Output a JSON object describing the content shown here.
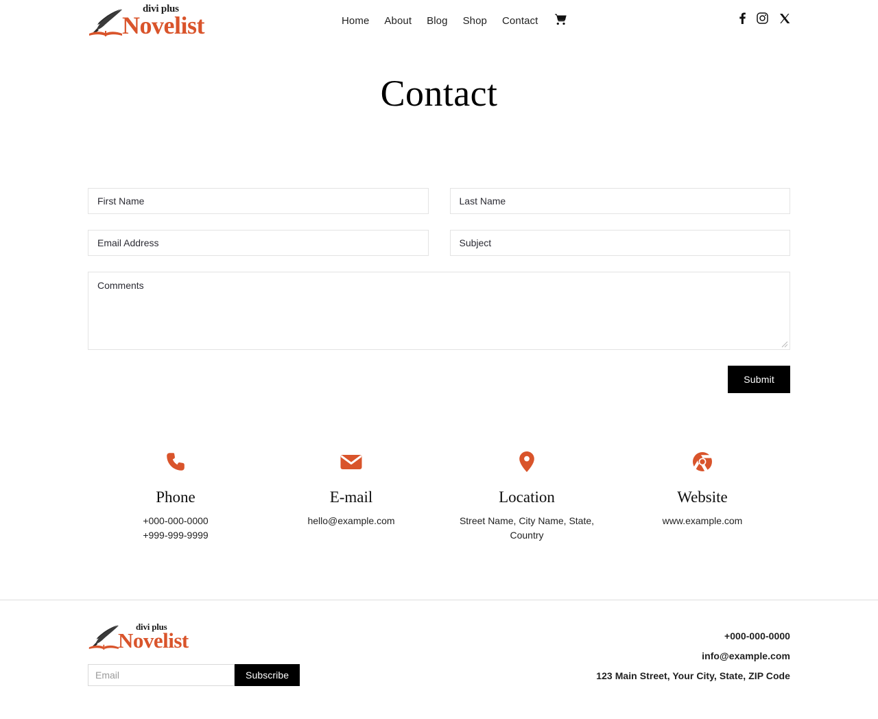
{
  "brand": {
    "name_top": "divi plus",
    "name_main": "Novelist",
    "logo_icon": "quill-and-book-icon",
    "accent_color": "#d9542b"
  },
  "header": {
    "nav": [
      {
        "label": "Home",
        "name": "nav-item-home"
      },
      {
        "label": "About",
        "name": "nav-item-about"
      },
      {
        "label": "Blog",
        "name": "nav-item-blog"
      },
      {
        "label": "Shop",
        "name": "nav-item-shop"
      },
      {
        "label": "Contact",
        "name": "nav-item-contact"
      }
    ],
    "cart_icon": "shopping-cart-icon",
    "social": [
      {
        "icon": "facebook-icon"
      },
      {
        "icon": "instagram-icon"
      },
      {
        "icon": "x-twitter-icon"
      }
    ]
  },
  "page": {
    "title": "Contact"
  },
  "form": {
    "first_name_placeholder": "First Name",
    "last_name_placeholder": "Last Name",
    "email_placeholder": "Email Address",
    "subject_placeholder": "Subject",
    "comments_placeholder": "Comments",
    "submit_label": "Submit"
  },
  "blurbs": [
    {
      "icon": "phone-icon",
      "title": "Phone",
      "lines": [
        "+000-000-0000",
        "+999-999-9999"
      ]
    },
    {
      "icon": "envelope-icon",
      "title": "E-mail",
      "lines": [
        "hello@example.com"
      ]
    },
    {
      "icon": "map-pin-icon",
      "title": "Location",
      "lines": [
        "Street Name, City Name, State,",
        "Country"
      ]
    },
    {
      "icon": "chrome-browser-icon",
      "title": "Website",
      "lines": [
        "www.example.com"
      ]
    }
  ],
  "footer": {
    "email_placeholder": "Email",
    "subscribe_label": "Subscribe",
    "contact": [
      "+000-000-0000",
      "info@example.com",
      "123 Main Street, Your City, State, ZIP Code"
    ]
  }
}
